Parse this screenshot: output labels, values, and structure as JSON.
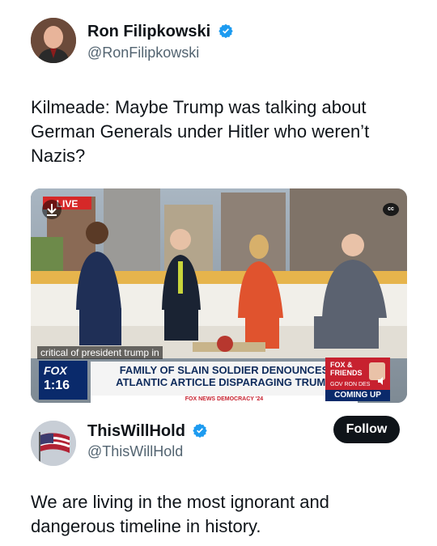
{
  "tweet1": {
    "author_name": "Ron Filipkowski",
    "handle": "@RonFilipkowski",
    "text": "Kilmeade: Maybe Trump was talking about German Generals under Hitler who weren’t Nazis?",
    "verified_color": "#1d9bf0"
  },
  "video": {
    "live_label": "LIVE",
    "cc_label": "cc",
    "caption": "critical of president trump in",
    "timestamp": "1:16",
    "channel_logo": "FOX",
    "headline_line1": "FAMILY OF SLAIN SOLDIER DENOUNCES",
    "headline_line2": "ATLANTIC ARTICLE DISPARAGING TRUMP",
    "subbar": "FOX NEWS DEMOCRACY '24",
    "show_logo": "FOX & FRIENDS",
    "coming_up_label": "COMING UP",
    "promo_text": "GOV RON DES"
  },
  "tweet2": {
    "author_name": "ThisWillHold",
    "handle": "@ThisWillHold",
    "follow_label": "Follow",
    "text": "We are living in the most ignorant and dangerous timeline in history."
  }
}
